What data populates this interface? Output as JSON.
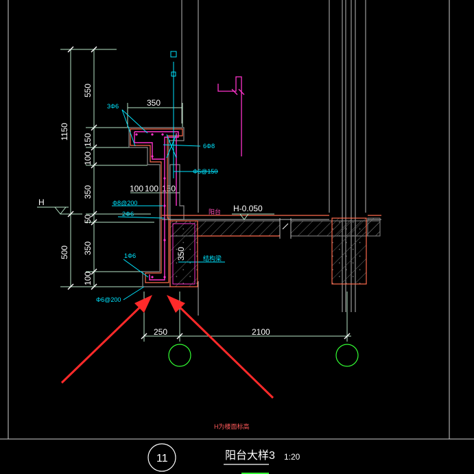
{
  "colors": {
    "background": "#000000",
    "dimension": "#b8e6c8",
    "text": "#ffffff",
    "rebar_label": "#00e5ff",
    "rebar": "#ff33cc",
    "concrete": "#8a8a8a",
    "outline": "#ff6b4d",
    "annotation_arrow": "#ff2a2a",
    "axis_circle": "#33ff33"
  },
  "dimensions": {
    "vertical_total": "1150",
    "left_segments": [
      "550",
      "150",
      "100",
      "350",
      "50",
      "350",
      "100"
    ],
    "lower_total": "500",
    "top_width": "350",
    "mid_widths": [
      "100",
      "100",
      "150"
    ],
    "bottom_left": "250",
    "bottom_right": "2100"
  },
  "labels": {
    "level_marker": "H",
    "rebar_top": "3Φ6",
    "rebar_6phi8": "6Φ8",
    "stirrup_150": "Φ6@150",
    "stirrup_200_upper": "Φ8@200",
    "rebar_2phi6": "2Φ6",
    "rebar_1phi6": "1Φ6",
    "stirrup_200_lower": "Φ6@200",
    "balcony": "阳台",
    "level_value": "H-0.050",
    "beam": "结构梁",
    "slab_350": "350",
    "footnote": "H为楼面标高"
  },
  "axis_circles": [
    "",
    ""
  ],
  "title_block": {
    "number": "11",
    "title": "阳台大样3",
    "scale": "1:20"
  }
}
